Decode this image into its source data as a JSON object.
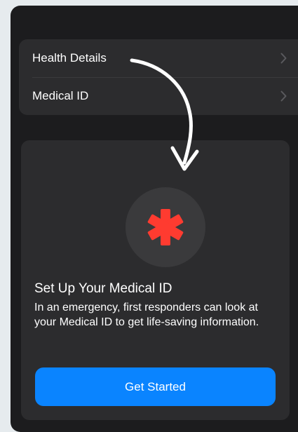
{
  "settings_list": {
    "items": [
      {
        "label": "Health Details",
        "icon": "chevron-right-icon"
      },
      {
        "label": "Medical ID",
        "icon": "chevron-right-icon"
      }
    ]
  },
  "medical_id_card": {
    "icon": "asterisk-icon",
    "title": "Set Up Your Medical ID",
    "description": "In an emergency, first responders can look at your Medical ID to get life-saving information.",
    "button_label": "Get Started"
  },
  "colors": {
    "page_background": "#e6ebee",
    "screen_background": "#1c1c1e",
    "cell_background": "#2c2c2e",
    "accent_blue": "#0a84ff",
    "medical_red": "#ff3b30",
    "annotation_arrow": "#ffffff"
  }
}
